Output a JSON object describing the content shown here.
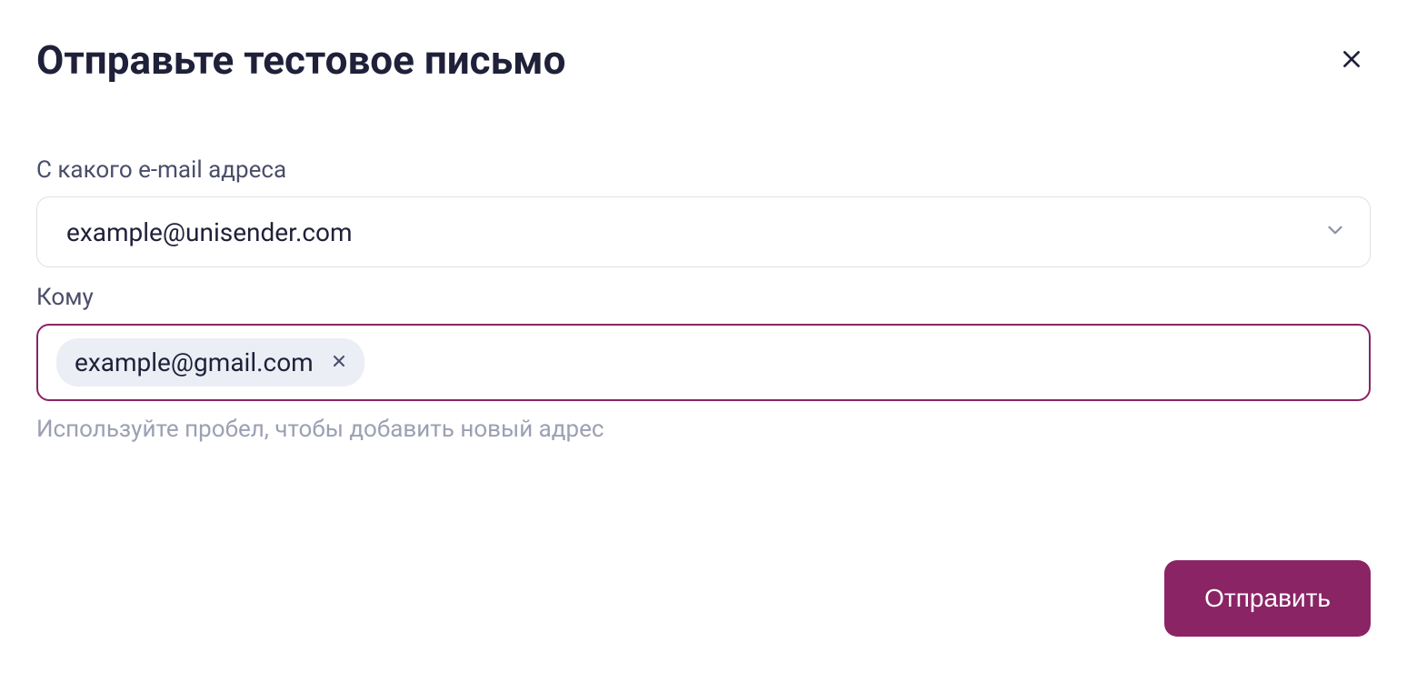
{
  "dialog": {
    "title": "Отправьте тестовое письмо"
  },
  "from_field": {
    "label": "С какого e-mail адреса",
    "value": "example@unisender.com"
  },
  "to_field": {
    "label": "Кому",
    "tags": [
      {
        "email": "example@gmail.com"
      }
    ],
    "hint": "Используйте пробел, чтобы добавить новый адрес"
  },
  "actions": {
    "send_label": "Отправить"
  }
}
